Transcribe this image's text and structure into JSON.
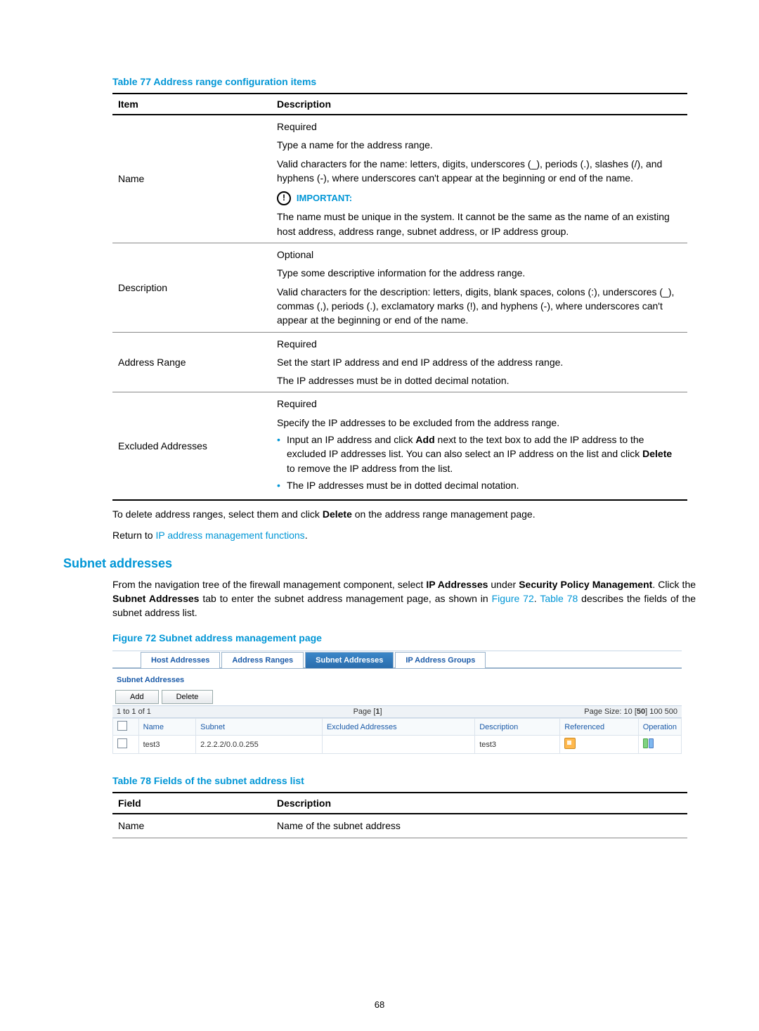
{
  "table77": {
    "caption": "Table 77 Address range configuration items",
    "head_item": "Item",
    "head_desc": "Description",
    "rows": {
      "name": {
        "item": "Name",
        "p1": "Required",
        "p2": "Type a name for the address range.",
        "p3": "Valid characters for the name: letters, digits, underscores (_), periods (.), slashes (/), and hyphens (-), where underscores can't appear at the beginning or end of the name.",
        "important_label": "IMPORTANT:",
        "p4": "The name must be unique in the system. It cannot be the same as the name of an existing host address, address range, subnet address, or IP address group."
      },
      "description": {
        "item": "Description",
        "p1": "Optional",
        "p2": "Type some descriptive information for the address range.",
        "p3": "Valid characters for the description: letters, digits, blank spaces, colons (:), underscores (_), commas (,), periods (.), exclamatory marks (!), and hyphens (-), where underscores can't appear at the beginning or end of the name."
      },
      "addrrange": {
        "item": "Address Range",
        "p1": "Required",
        "p2": "Set the start IP address and end IP address of the address range.",
        "p3": "The IP addresses must be in dotted decimal notation."
      },
      "excluded": {
        "item": "Excluded Addresses",
        "p1": "Required",
        "p2": "Specify the IP addresses to be excluded from the address range.",
        "b1a": "Input an IP address and click ",
        "b1_add": "Add",
        "b1b": " next to the text box to add the IP address to the excluded IP addresses list. You can also select an IP address on the list and click ",
        "b1_del": "Delete",
        "b1c": " to remove the IP address from the list.",
        "b2": "The IP addresses must be in dotted decimal notation."
      }
    }
  },
  "para1a": "To delete address ranges, select them and click ",
  "para1_delete": "Delete",
  "para1b": " on the address range management page.",
  "para2a": "Return to ",
  "para2_link": "IP address management functions",
  "para2b": ".",
  "h2_subnet": "Subnet addresses",
  "para3a": "From the navigation tree of the firewall management component, select ",
  "para3_ip": "IP Addresses",
  "para3b": " under ",
  "para3_spm": "Security Policy Management",
  "para3c": ". Click the ",
  "para3_tab": "Subnet Addresses",
  "para3d": " tab to enter the subnet address management page, as shown in ",
  "para3_fig": "Figure 72",
  "para3e": ". ",
  "para3_tbl": "Table 78",
  "para3f": " describes the fields of the subnet address list.",
  "figure72": "Figure 72 Subnet address management page",
  "screenshot": {
    "tabs": [
      "Host Addresses",
      "Address Ranges",
      "Subnet Addresses",
      "IP Address Groups"
    ],
    "panel_title": "Subnet Addresses",
    "btn_add": "Add",
    "btn_delete": "Delete",
    "paginator_left": "1 to 1 of 1",
    "paginator_center_a": "Page [",
    "paginator_center_num": "1",
    "paginator_center_b": "]",
    "paginator_right_a": "Page Size: 10 [",
    "paginator_right_50": "50",
    "paginator_right_b": "] 100 500",
    "headers": [
      "",
      "Name",
      "Subnet",
      "Excluded Addresses",
      "Description",
      "Referenced",
      "Operation"
    ],
    "row": {
      "name": "test3",
      "subnet": "2.2.2.2/0.0.0.255",
      "excluded": "",
      "description": "test3"
    }
  },
  "table78": {
    "caption": "Table 78 Fields of the subnet address list",
    "head_field": "Field",
    "head_desc": "Description",
    "row_name_field": "Name",
    "row_name_desc": "Name of the subnet address"
  },
  "pagenum": "68"
}
